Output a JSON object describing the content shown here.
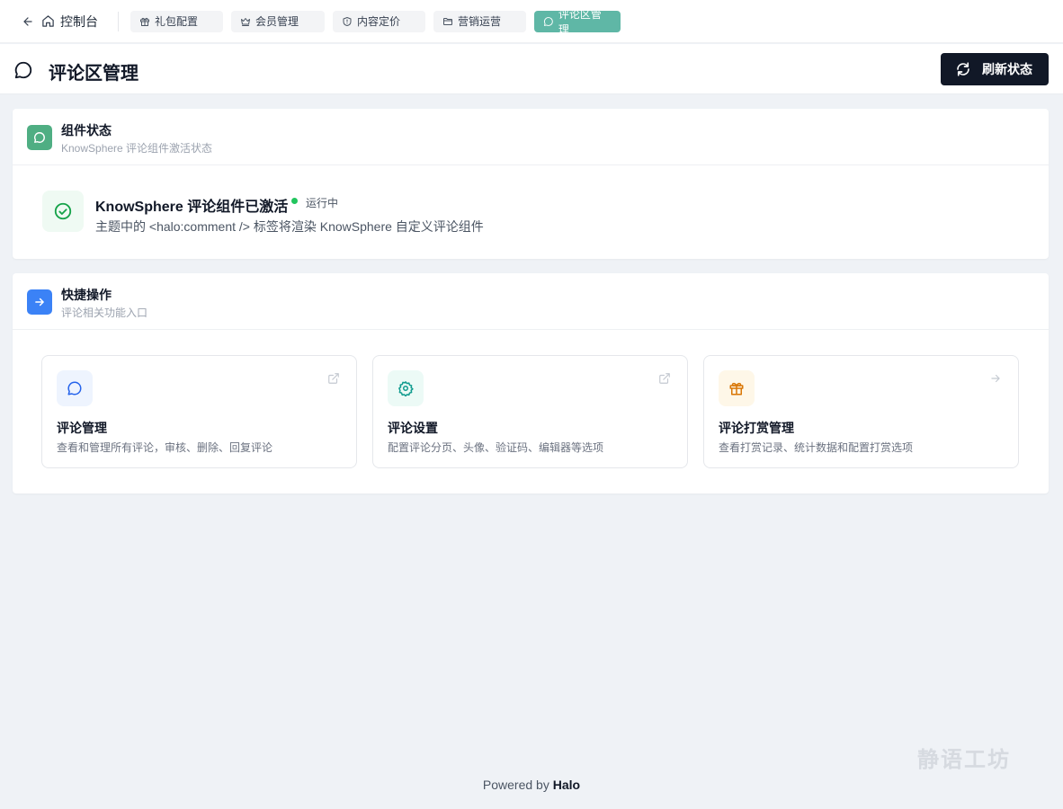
{
  "nav": {
    "home_label": "控制台",
    "tabs": [
      {
        "label": "礼包配置",
        "icon": "gift-icon"
      },
      {
        "label": "会员管理",
        "icon": "crown-icon"
      },
      {
        "label": "内容定价",
        "icon": "shield-icon"
      },
      {
        "label": "营销运营",
        "icon": "folder-icon"
      },
      {
        "label": "评论区管理",
        "icon": "comment-icon",
        "active": true
      }
    ]
  },
  "header": {
    "title": "评论区管理",
    "refresh_label": "刷新状态"
  },
  "status_card": {
    "title": "组件状态",
    "subtitle": "KnowSphere 评论组件激活状态",
    "status_title": "KnowSphere 评论组件已激活",
    "status_badge": "运行中",
    "description": "主题中的 <halo:comment /> 标签将渲染 KnowSphere 自定义评论组件"
  },
  "quick_card": {
    "title": "快捷操作",
    "subtitle": "评论相关功能入口",
    "items": [
      {
        "title": "评论管理",
        "desc": "查看和管理所有评论，审核、删除、回复评论",
        "icon": "comment-icon",
        "corner_icon": "external-link-icon"
      },
      {
        "title": "评论设置",
        "desc": "配置评论分页、头像、验证码、编辑器等选项",
        "icon": "gear-icon",
        "corner_icon": "external-link-icon"
      },
      {
        "title": "评论打赏管理",
        "desc": "查看打赏记录、统计数据和配置打赏选项",
        "icon": "gift-icon",
        "corner_icon": "arrow-right-icon"
      }
    ]
  },
  "watermark": "静语工坊",
  "footer": {
    "prefix": "Powered by",
    "brand": "Halo"
  },
  "colors": {
    "accent_teal": "#5fb7a6",
    "status_green": "#22c55e",
    "primary_dark": "#111827",
    "quick_blue": "#3b82f6"
  }
}
